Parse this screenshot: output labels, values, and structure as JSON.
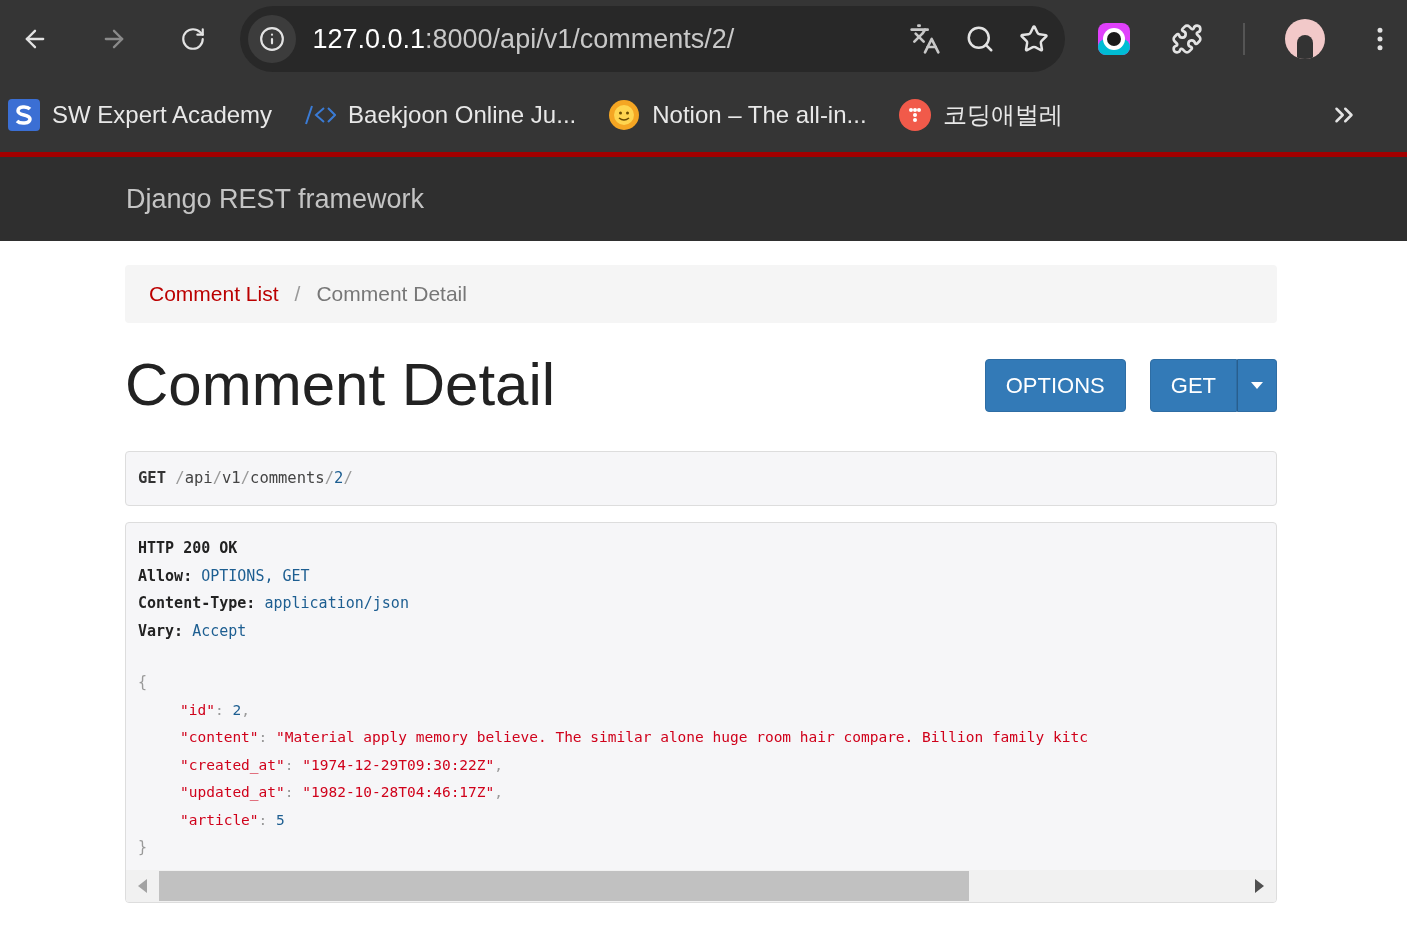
{
  "browser": {
    "url_host": "127.0.0.1",
    "url_path": ":8000/api/v1/comments/2/",
    "forward_disabled": true
  },
  "bookmarks": [
    {
      "label": "SW Expert Academy",
      "kind": "swea"
    },
    {
      "label": "Baekjoon Online Ju...",
      "kind": "code"
    },
    {
      "label": "Notion – The all-in...",
      "kind": "sun"
    },
    {
      "label": "코딩애벌레",
      "kind": "dots"
    }
  ],
  "navbar": {
    "brand": "Django REST framework"
  },
  "breadcrumb": [
    {
      "label": "Comment List",
      "selected": false
    },
    {
      "label": "Comment Detail",
      "selected": true
    }
  ],
  "breadcrumb_separator": "/",
  "title": "Comment Detail",
  "buttons": [
    {
      "label": "OPTIONS",
      "kind": "plain"
    },
    {
      "label": "GET",
      "kind": "split"
    }
  ],
  "request": {
    "method": "GET",
    "path_parts": [
      "/",
      "api",
      "/",
      "v1",
      "/",
      "comments",
      "/",
      "2",
      "/"
    ]
  },
  "response": {
    "status": "HTTP 200 OK",
    "headers": [
      {
        "name": "Allow:",
        "value": "OPTIONS, GET"
      },
      {
        "name": "Content-Type:",
        "value": "application/json"
      },
      {
        "name": "Vary:",
        "value": "Accept"
      }
    ],
    "open": "{",
    "close": "}",
    "fields": [
      {
        "key": "\"id\"",
        "colon": ":",
        "value": "2",
        "kind": "number",
        "comma": ","
      },
      {
        "key": "\"content\"",
        "colon": ":",
        "value": "\"Material apply memory believe. The similar alone huge room hair compare. Billion family kitc",
        "kind": "string"
      },
      {
        "key": "\"created_at\"",
        "colon": ":",
        "value": "\"1974-12-29T09:30:22Z\"",
        "kind": "string",
        "comma": ","
      },
      {
        "key": "\"updated_at\"",
        "colon": ":",
        "value": "\"1982-10-28T04:46:17Z\"",
        "kind": "string",
        "comma": ","
      },
      {
        "key": "\"article\"",
        "colon": ":",
        "value": "5",
        "kind": "number"
      }
    ]
  }
}
